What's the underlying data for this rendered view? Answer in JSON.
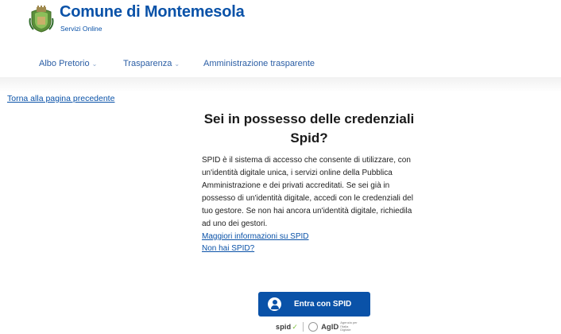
{
  "header": {
    "title": "Comune di Montemesola",
    "subtitle": "Servizi Online",
    "crest_icon": "municipal-crest-icon"
  },
  "nav": {
    "items": [
      {
        "label": "Albo Pretorio",
        "has_dropdown": true
      },
      {
        "label": "Trasparenza",
        "has_dropdown": true
      },
      {
        "label": "Amministrazione trasparente",
        "has_dropdown": false
      }
    ]
  },
  "back_link": "Torna alla pagina precedente",
  "spid_card": {
    "heading_line1": "Sei in possesso delle credenziali",
    "heading_line2": "Spid?",
    "description": "SPID è il sistema di accesso che consente di utilizzare, con un'identità digitale unica, i servizi online della Pubblica Amministrazione e dei privati accreditati. Se sei già in possesso di un'identità digitale, accedi con le credenziali del tuo gestore. Se non hai ancora un'identità digitale, richiedila ad uno dei gestori.",
    "link_more_info": "Maggiori informazioni su SPID",
    "link_no_spid": "Non hai SPID?"
  },
  "login_button": {
    "label": "Entra con SPID",
    "icon": "user-avatar-icon"
  },
  "footer_logos": {
    "spid_text": "spid",
    "agid_text": "AgID",
    "agid_small": "Agenzia per l'Italia Digitale"
  },
  "colors": {
    "brand_blue": "#0a52a8",
    "nav_link": "#2b5ea5",
    "spid_check_green": "#7fbf3f"
  }
}
